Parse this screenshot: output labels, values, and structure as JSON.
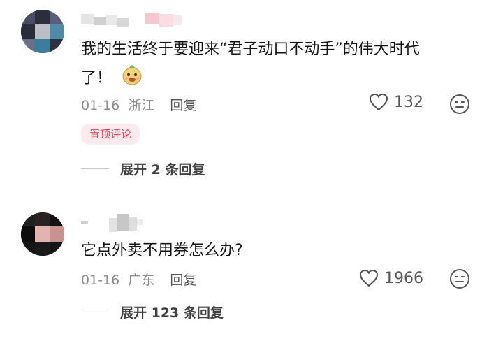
{
  "comments": [
    {
      "text_line1": "我的生活终于要迎来“君子动口不动手”的伟大时代",
      "text_line2": "了！",
      "emoji": "melon-face-sticker",
      "date": "01-16",
      "location": "浙江",
      "reply_label": "回复",
      "likes": "132",
      "badge": "置顶评论",
      "expand_label": "展开 2 条回复"
    },
    {
      "text_line1": "它点外卖不用券怎么办?",
      "date": "01-16",
      "location": "广东",
      "reply_label": "回复",
      "likes": "1966",
      "expand_label": "展开 123 条回复"
    }
  ],
  "colors": {
    "badge_bg": "#fcebee",
    "badge_text": "#e5465b",
    "meta_text": "#8d8d8d"
  }
}
